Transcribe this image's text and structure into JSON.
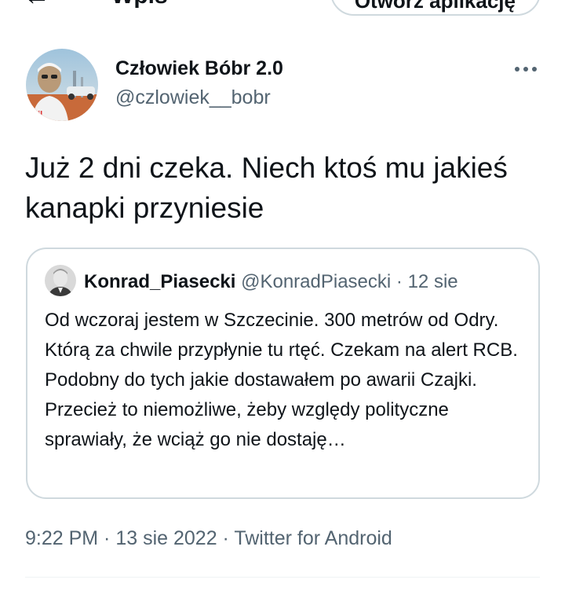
{
  "top": {
    "back_icon": "arrow-left-icon",
    "title": "Wpis",
    "pill_label": "Otwórz aplikację"
  },
  "author": {
    "display_name": "Człowiek Bóbr 2.0",
    "handle": "@czlowiek__bobr"
  },
  "tweet": {
    "text": "Już 2 dni czeka. Niech ktoś mu jakieś kanapki przyniesie"
  },
  "quote": {
    "name": "Konrad_Piasecki",
    "handle": "@KonradPiasecki",
    "separator": "·",
    "date": "12 sie",
    "text": "Od wczoraj jestem w Szczecinie. 300 metrów od Odry. Którą za chwile przypłynie tu rtęć. Czekam na alert RCB. Podobny do tych jakie dostawałem po awarii Czajki. Przecież to niemożliwe, żeby względy polityczne sprawiały, że wciąż go nie dostaję…"
  },
  "meta": {
    "line": "9:22 PM · 13 sie 2022 · Twitter for Android"
  },
  "colors": {
    "text": "#0f1419",
    "secondary": "#536471",
    "border": "#cfd9de"
  }
}
